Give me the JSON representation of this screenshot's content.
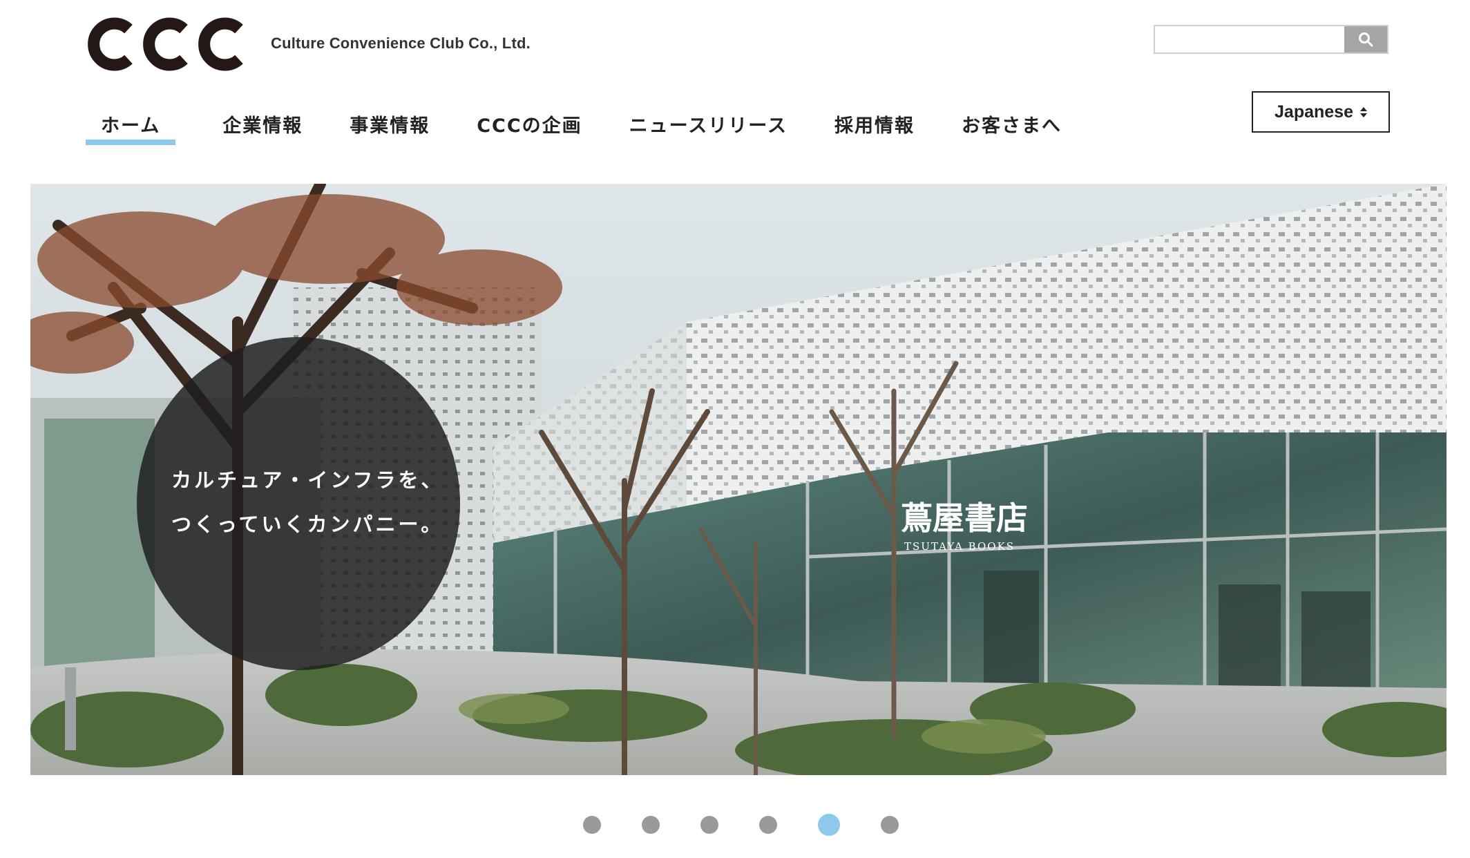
{
  "header": {
    "logo_text": "CCC",
    "company_name": "Culture Convenience Club Co., Ltd.",
    "search": {
      "value": "",
      "placeholder": "",
      "icon": "search-icon"
    },
    "language": {
      "selected": "Japanese",
      "icon": "sort-arrows-icon"
    }
  },
  "nav": {
    "items": [
      {
        "label": "ホーム",
        "active": true
      },
      {
        "label": "企業情報",
        "active": false
      },
      {
        "label": "事業情報",
        "active": false
      },
      {
        "label": "CCCの企画",
        "active": false
      },
      {
        "label": "ニュースリリース",
        "active": false
      },
      {
        "label": "採用情報",
        "active": false
      },
      {
        "label": "お客さまへ",
        "active": false
      }
    ],
    "active_color": "#8ec8ec"
  },
  "hero": {
    "tagline_line1": "カルチュア・インフラを、",
    "tagline_line2": "つくっていくカンパニー。",
    "sign_text": "蔦屋書店",
    "sign_subtext": "TSUTAYA BOOKS"
  },
  "carousel": {
    "total": 6,
    "active_index": 4,
    "dot_color": "#9a9a9a",
    "active_color": "#8ec8ec"
  }
}
